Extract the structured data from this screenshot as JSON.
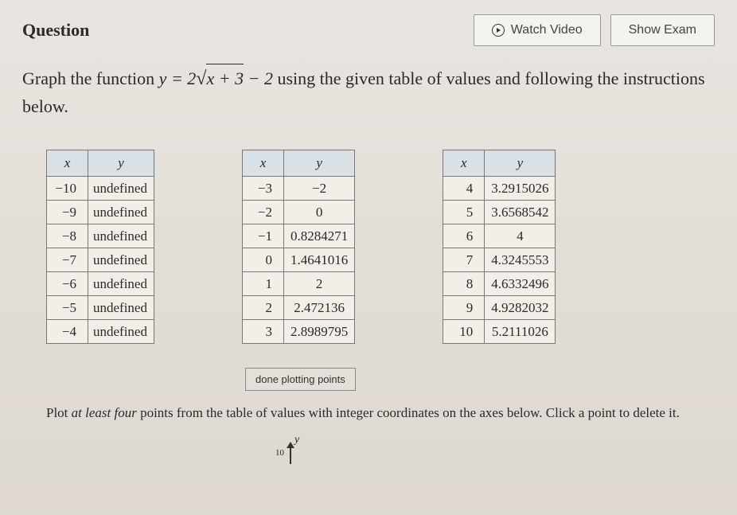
{
  "header": {
    "title": "Question",
    "watch_video_label": "Watch Video",
    "show_exam_label": "Show Exam"
  },
  "problem": {
    "prefix": "Graph the function ",
    "eq_lhs": "y",
    "eq_eq": " = ",
    "eq_coef": "2",
    "eq_radicand": "x + 3",
    "eq_tail": " − 2",
    "suffix": " using the given table of values and following the instructions below."
  },
  "table_headers": {
    "x": "x",
    "y": "y"
  },
  "table1": [
    {
      "x": "−10",
      "y": "undefined"
    },
    {
      "x": "−9",
      "y": "undefined"
    },
    {
      "x": "−8",
      "y": "undefined"
    },
    {
      "x": "−7",
      "y": "undefined"
    },
    {
      "x": "−6",
      "y": "undefined"
    },
    {
      "x": "−5",
      "y": "undefined"
    },
    {
      "x": "−4",
      "y": "undefined"
    }
  ],
  "table2": [
    {
      "x": "−3",
      "y": "−2"
    },
    {
      "x": "−2",
      "y": "0"
    },
    {
      "x": "−1",
      "y": "0.8284271"
    },
    {
      "x": "0",
      "y": "1.4641016"
    },
    {
      "x": "1",
      "y": "2"
    },
    {
      "x": "2",
      "y": "2.472136"
    },
    {
      "x": "3",
      "y": "2.8989795"
    }
  ],
  "table3": [
    {
      "x": "4",
      "y": "3.2915026"
    },
    {
      "x": "5",
      "y": "3.6568542"
    },
    {
      "x": "6",
      "y": "4"
    },
    {
      "x": "7",
      "y": "4.3245553"
    },
    {
      "x": "8",
      "y": "4.6332496"
    },
    {
      "x": "9",
      "y": "4.9282032"
    },
    {
      "x": "10",
      "y": "5.2111026"
    }
  ],
  "done_button": "done plotting points",
  "instructions": {
    "part1": "Plot ",
    "emph": "at least four",
    "part2": " points from the table of values with integer coordinates on the axes below. Click a point to delete it."
  },
  "axis": {
    "y_label": "y",
    "tick": "10"
  }
}
